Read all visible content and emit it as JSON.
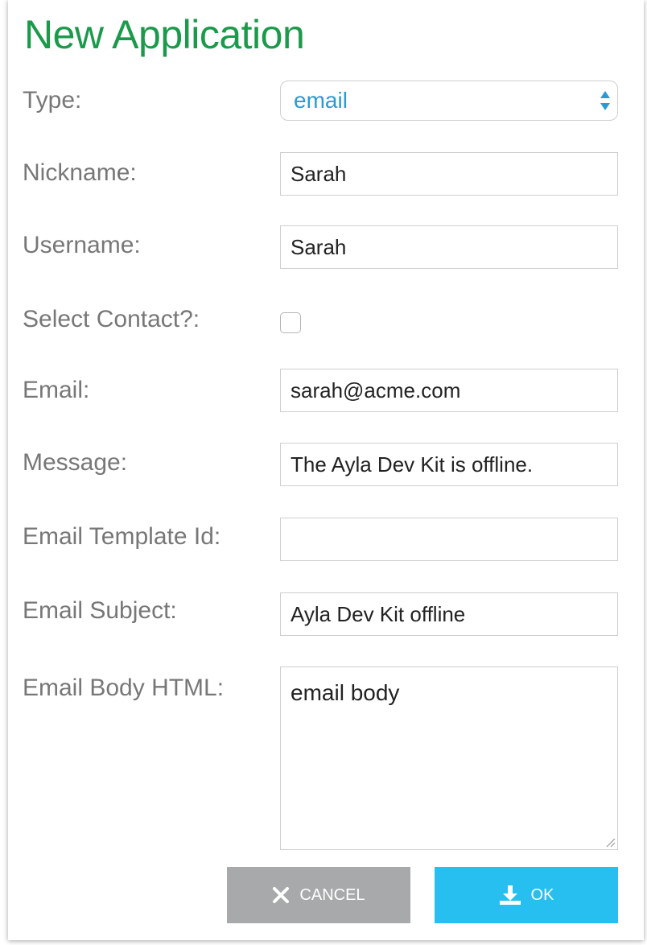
{
  "dialog": {
    "title": "New Application"
  },
  "form": {
    "type": {
      "label": "Type:",
      "value": "email"
    },
    "nickname": {
      "label": "Nickname:",
      "value": "Sarah"
    },
    "username": {
      "label": "Username:",
      "value": "Sarah"
    },
    "select_contact": {
      "label": "Select Contact?:",
      "checked": false
    },
    "email": {
      "label": "Email:",
      "value": "sarah@acme.com"
    },
    "message": {
      "label": "Message:",
      "value": "The Ayla Dev Kit is offline."
    },
    "email_template_id": {
      "label": "Email Template Id:",
      "value": ""
    },
    "email_subject": {
      "label": "Email Subject:",
      "value": "Ayla Dev Kit offline"
    },
    "email_body_html": {
      "label": "Email Body HTML:",
      "value": "email body"
    }
  },
  "buttons": {
    "cancel": {
      "label": "CANCEL",
      "icon": "close-icon"
    },
    "ok": {
      "label": "OK",
      "icon": "download-icon"
    }
  },
  "colors": {
    "title": "#1a9a4a",
    "select_value": "#2a9ad4",
    "cancel_bg": "#a8a9ab",
    "ok_bg": "#26bfef"
  }
}
